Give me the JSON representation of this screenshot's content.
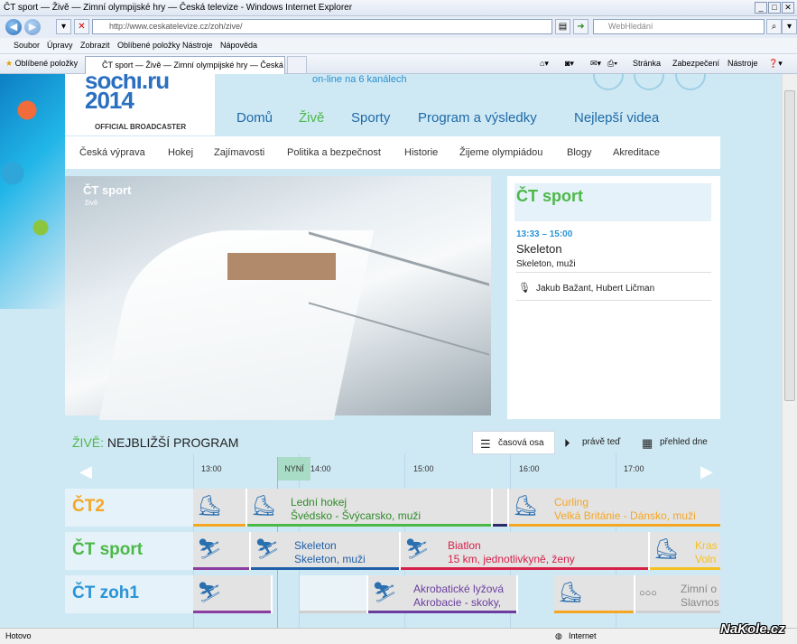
{
  "window": {
    "title": "ČT sport — Živě — Zimní olympijské hry — Česká televize - Windows Internet Explorer"
  },
  "address": {
    "url": "http://www.ceskatelevize.cz/zoh/zive/",
    "search_placeholder": "WebHledání"
  },
  "menu": [
    "Soubor",
    "Úpravy",
    "Zobrazit",
    "Oblíbené položky",
    "Nástroje",
    "Nápověda"
  ],
  "favbar": {
    "favorites": "Oblíbené položky",
    "tab_title": "ČT sport — Živě — Zimní olympijské hry — Česká televize — Česká tel...",
    "tools": [
      "Stránka",
      "Zabezpečení",
      "Nástroje"
    ]
  },
  "status": {
    "left": "Hotovo",
    "zone": "Internet"
  },
  "site": {
    "logo": "sochi.ru 2014",
    "broadcaster": "OFFICIAL BROADCASTER",
    "online": "on-line na 6 kanálech",
    "nav": [
      "Domů",
      "Živě",
      "Sporty",
      "Program a výsledky",
      "Nejlepší videa"
    ],
    "subnav": [
      "Česká výprava",
      "Hokej",
      "Zajímavosti",
      "Politika a bezpečnost",
      "Historie",
      "Žijeme olympiádou",
      "Blogy",
      "Akreditace"
    ]
  },
  "player": {
    "watermark": "ČT sport",
    "watermark_sub": "živě"
  },
  "now": {
    "channel": "ČT sport",
    "time": "13:33 – 15:00",
    "title": "Skeleton",
    "subtitle": "Skeleton, muži",
    "commentators": "Jakub Bažant, Hubert Ličman"
  },
  "program": {
    "title_prefix": "ŽIVĚ:",
    "title": "NEJBLIŽŠÍ PROGRAM",
    "views": [
      "časová osa",
      "právě teď",
      "přehled dne"
    ],
    "now_label": "NYNÍ",
    "hours": [
      "13:00",
      "14:00",
      "15:00",
      "16:00",
      "17:00"
    ],
    "channels": [
      {
        "logo": "ČT2",
        "color": "#f5a623",
        "events": [
          {
            "line1": "",
            "line2": "",
            "icon": "⛸",
            "bar": "#f5a623"
          },
          {
            "line1": "Lední hokej",
            "line2": "Švédsko - Švýcarsko, muži",
            "icon": "⛸",
            "bar": "#4cb848",
            "color": "#2f8a2a"
          },
          {
            "line1": "",
            "line2": "",
            "icon": "",
            "bar": "#2b2b6a"
          },
          {
            "line1": "Curling",
            "line2": "Velká Británie - Dánsko, muži",
            "icon": "⛸",
            "bar": "#f5a623",
            "color": "#f5a623"
          }
        ]
      },
      {
        "logo": "ČT sport",
        "color": "#4cb848",
        "events": [
          {
            "line1": "",
            "line2": "",
            "icon": "⛷",
            "bar": "#8a3d9e"
          },
          {
            "line1": "Skeleton",
            "line2": "Skeleton, muži",
            "icon": "⛷",
            "bar": "#1f5fa8",
            "color": "#1f5fa8"
          },
          {
            "line1": "Biatlon",
            "line2": "15 km, jednotlivkyně, ženy",
            "icon": "⛷",
            "bar": "#d6204a",
            "color": "#d6204a"
          },
          {
            "line1": "Kras",
            "line2": "Voln",
            "icon": "⛸",
            "bar": "#f5c023",
            "color": "#f5c023"
          }
        ]
      },
      {
        "logo": "ČT zoh1",
        "color": "#2a94d6",
        "events": [
          {
            "line1": "",
            "line2": "",
            "icon": "⛷",
            "bar": "#8a3d9e"
          },
          {
            "line1": "",
            "line2": "",
            "icon": "",
            "bar": "#cfcfcf"
          },
          {
            "line1": "Akrobatické lyžová",
            "line2": "Akrobacie - skoky,",
            "icon": "⛷",
            "bar": "#6a3d9e",
            "color": "#6a3d9e"
          },
          {
            "line1": "",
            "line2": "",
            "icon": "⛸",
            "bar": "#f5a623"
          },
          {
            "line1": "Zimní o",
            "line2": "Slavnos",
            "icon": "○○○",
            "bar": "#cfcfcf",
            "color": "#888"
          }
        ]
      }
    ]
  },
  "watermark": "NaKole.cz"
}
